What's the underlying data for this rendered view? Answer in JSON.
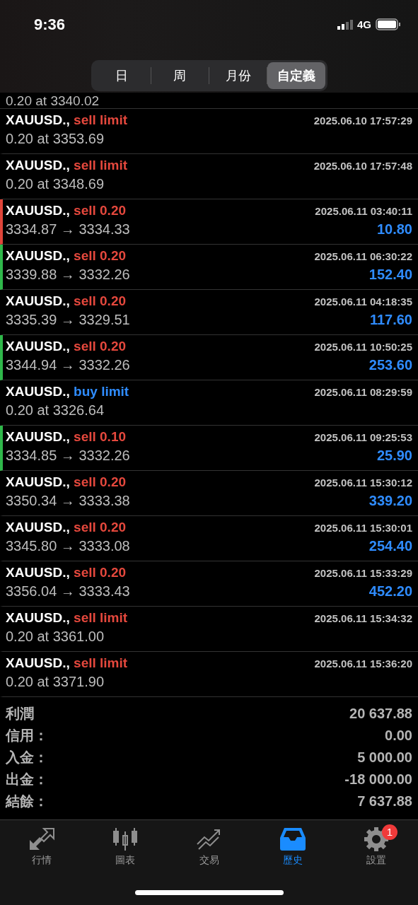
{
  "status_bar": {
    "time": "9:36",
    "network": "4G"
  },
  "period_tabs": [
    {
      "label": "日",
      "selected": false
    },
    {
      "label": "周",
      "selected": false
    },
    {
      "label": "月份",
      "selected": false
    },
    {
      "label": "自定義",
      "selected": true
    }
  ],
  "partial_row": {
    "detail": "0.20 at 3340.02"
  },
  "orders": [
    {
      "symbol": "XAUUSD.,",
      "type": "sell limit",
      "kind": "sell",
      "time": "2025.06.10 17:57:29",
      "detail": "0.20 at 3353.69"
    },
    {
      "symbol": "XAUUSD.,",
      "type": "sell limit",
      "kind": "sell",
      "time": "2025.06.10 17:57:48",
      "detail": "0.20 at 3348.69"
    },
    {
      "symbol": "XAUUSD.,",
      "type": "sell 0.20",
      "kind": "sell",
      "time": "2025.06.11 03:40:11",
      "detail": "3334.87 → 3334.33",
      "profit": "10.80",
      "color": "#e0453a"
    },
    {
      "symbol": "XAUUSD.,",
      "type": "sell 0.20",
      "kind": "sell",
      "time": "2025.06.11 06:30:22",
      "detail": "3339.88 → 3332.26",
      "profit": "152.40",
      "color": "#2fb84a"
    },
    {
      "symbol": "XAUUSD.,",
      "type": "sell 0.20",
      "kind": "sell",
      "time": "2025.06.11 04:18:35",
      "detail": "3335.39 → 3329.51",
      "profit": "117.60"
    },
    {
      "symbol": "XAUUSD.,",
      "type": "sell 0.20",
      "kind": "sell",
      "time": "2025.06.11 10:50:25",
      "detail": "3344.94 → 3332.26",
      "profit": "253.60",
      "color": "#2fb84a"
    },
    {
      "symbol": "XAUUSD.,",
      "type": "buy limit",
      "kind": "buy",
      "time": "2025.06.11 08:29:59",
      "detail": "0.20 at 3326.64"
    },
    {
      "symbol": "XAUUSD.,",
      "type": "sell 0.10",
      "kind": "sell",
      "time": "2025.06.11 09:25:53",
      "detail": "3334.85 → 3332.26",
      "profit": "25.90",
      "color": "#2fb84a"
    },
    {
      "symbol": "XAUUSD.,",
      "type": "sell 0.20",
      "kind": "sell",
      "time": "2025.06.11 15:30:12",
      "detail": "3350.34 → 3333.38",
      "profit": "339.20"
    },
    {
      "symbol": "XAUUSD.,",
      "type": "sell 0.20",
      "kind": "sell",
      "time": "2025.06.11 15:30:01",
      "detail": "3345.80 → 3333.08",
      "profit": "254.40"
    },
    {
      "symbol": "XAUUSD.,",
      "type": "sell 0.20",
      "kind": "sell",
      "time": "2025.06.11 15:33:29",
      "detail": "3356.04 → 3333.43",
      "profit": "452.20"
    },
    {
      "symbol": "XAUUSD.,",
      "type": "sell limit",
      "kind": "sell",
      "time": "2025.06.11 15:34:32",
      "detail": "0.20 at 3361.00"
    },
    {
      "symbol": "XAUUSD.,",
      "type": "sell limit",
      "kind": "sell",
      "time": "2025.06.11 15:36:20",
      "detail": "0.20 at 3371.90"
    }
  ],
  "summary": [
    {
      "label": "利潤",
      "value": "20 637.88"
    },
    {
      "label": "信用：",
      "value": "0.00"
    },
    {
      "label": "入金：",
      "value": "5 000.00"
    },
    {
      "label": "出金：",
      "value": "-18 000.00"
    },
    {
      "label": "結餘：",
      "value": "7 637.88"
    }
  ],
  "tab_bar": [
    {
      "kind": "quotes",
      "label": "行情",
      "selected": false
    },
    {
      "kind": "chart",
      "label": "圖表",
      "selected": false
    },
    {
      "kind": "trade",
      "label": "交易",
      "selected": false
    },
    {
      "kind": "history",
      "label": "歷史",
      "selected": true
    },
    {
      "kind": "settings",
      "label": "設置",
      "selected": false,
      "badge": "1"
    }
  ]
}
